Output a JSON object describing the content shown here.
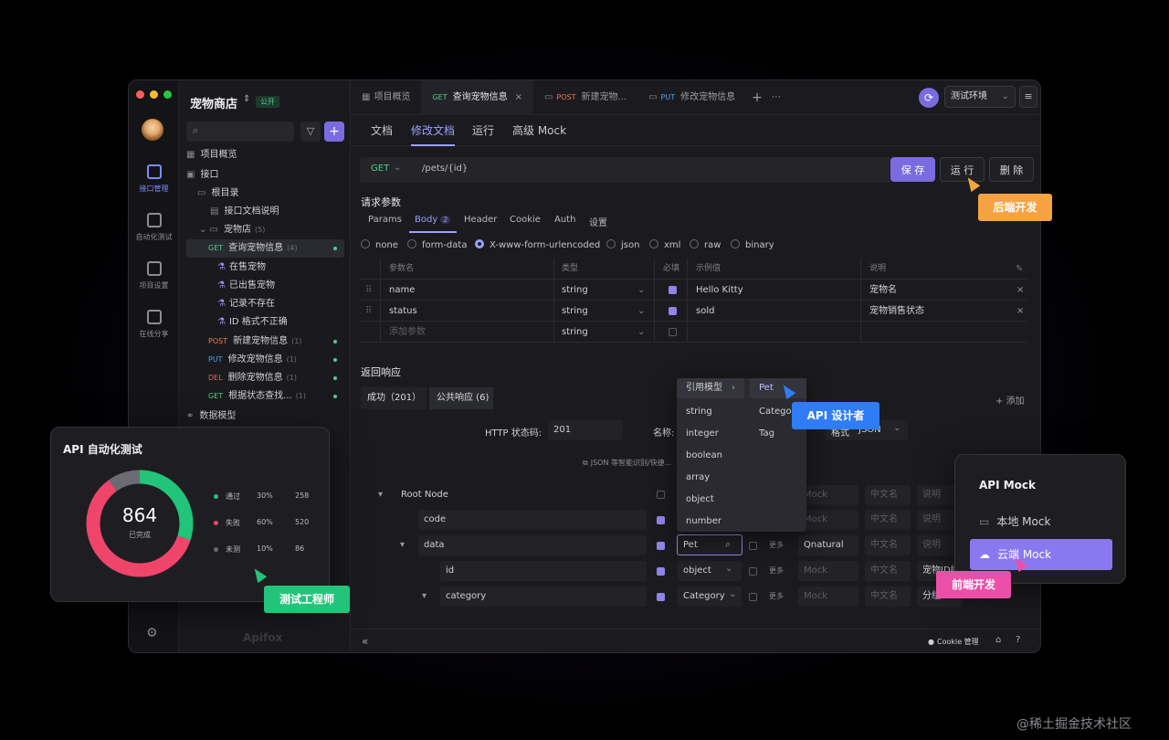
{
  "app": {
    "project": "宠物商店",
    "visibility": "公开",
    "env": "测试环境"
  },
  "rail": [
    {
      "label": "接口管理",
      "active": true
    },
    {
      "label": "自动化测试"
    },
    {
      "label": "项目设置"
    },
    {
      "label": "在线分享"
    }
  ],
  "tree": {
    "overview": "项目概览",
    "api": "接口",
    "root": "根目录",
    "doc": "接口文档说明",
    "petstore": "宠物店",
    "petstore_count": "(5)",
    "items": [
      {
        "method": "GET",
        "name": "查询宠物信息",
        "count": "(4)",
        "selected": true
      },
      {
        "name": "在售宠物"
      },
      {
        "name": "已出售宠物"
      },
      {
        "name": "记录不存在"
      },
      {
        "name": "ID 格式不正确"
      },
      {
        "method": "POST",
        "name": "新建宠物信息",
        "count": "(1)"
      },
      {
        "method": "PUT",
        "name": "修改宠物信息",
        "count": "(1)"
      },
      {
        "method": "DEL",
        "name": "删除宠物信息",
        "count": "(1)"
      },
      {
        "method": "GET",
        "name": "根据状态查找...",
        "count": "(1)"
      }
    ],
    "models": "数据模型",
    "brand": "Apifox"
  },
  "tabs": [
    {
      "label": "项目概览"
    },
    {
      "method": "GET",
      "label": "查询宠物信息",
      "active": true
    },
    {
      "method": "POST",
      "label": "新建宠物..."
    },
    {
      "method": "PUT",
      "label": "修改宠物信息"
    }
  ],
  "subtabs": [
    "文档",
    "修改文档",
    "运行",
    "高级 Mock"
  ],
  "request": {
    "method": "GET",
    "path": "/pets/{id}",
    "save": "保 存",
    "run": "运 行",
    "delete": "删 除"
  },
  "params_title": "请求参数",
  "param_tabs": [
    "Params",
    "Body",
    "Header",
    "Cookie",
    "Auth",
    "设置"
  ],
  "body_count": "2",
  "body_types": [
    "none",
    "form-data",
    "X-www-form-urlencoded",
    "json",
    "xml",
    "raw",
    "binary"
  ],
  "param_headers": [
    "参数名",
    "类型",
    "必填",
    "示例值",
    "说明"
  ],
  "params": [
    {
      "name": "name",
      "type": "string",
      "example": "Hello Kitty",
      "desc": "宠物名"
    },
    {
      "name": "status",
      "type": "string",
      "example": "sold",
      "desc": "宠物销售状态"
    }
  ],
  "add_param": "添加参数",
  "add_param_type": "string",
  "response": {
    "title": "返回响应",
    "tab_ok": "成功（201）",
    "tab_public": "公共响应 (6)",
    "add": "+ 添加",
    "status_label": "HTTP 状态码:",
    "status_value": "201",
    "name_label": "名称:",
    "format_label": "格式",
    "format_value": "JSON",
    "smart": "JSON 等智能识别/快捷..."
  },
  "schema": {
    "root": "Root Node",
    "rows": [
      "code",
      "data",
      "id",
      "category"
    ],
    "data_type": "Pet",
    "id_type": "object",
    "cat_type": "Category",
    "more": "更多",
    "mock_val": "Qnatural",
    "mock": "Mock",
    "cn": "中文名",
    "desc": "说明",
    "id_desc": "宠物ID编号",
    "cat_desc": "分组"
  },
  "dropdown": {
    "header": "引用模型",
    "selected": "Pet",
    "types": [
      "string",
      "integer",
      "boolean",
      "array",
      "object",
      "number"
    ],
    "models": [
      "Category",
      "Tag"
    ]
  },
  "footer": {
    "cookie": "Cookie 管理",
    "collapse": "«"
  },
  "test_card": {
    "title": "API 自动化测试",
    "total": "864",
    "done": "已完成",
    "legend": [
      {
        "label": "通过",
        "pct": "30%",
        "count": "258",
        "color": "#22c47a"
      },
      {
        "label": "失败",
        "pct": "60%",
        "count": "520",
        "color": "#f0456a"
      },
      {
        "label": "未测",
        "pct": "10%",
        "count": "86",
        "color": "#6b6b73"
      }
    ]
  },
  "mock_card": {
    "title": "API Mock",
    "local": "本地 Mock",
    "cloud": "云端 Mock"
  },
  "roles": {
    "backend": "后端开发",
    "designer": "API 设计者",
    "tester": "测试工程师",
    "frontend": "前端开发"
  },
  "watermark": "@稀土掘金技术社区"
}
